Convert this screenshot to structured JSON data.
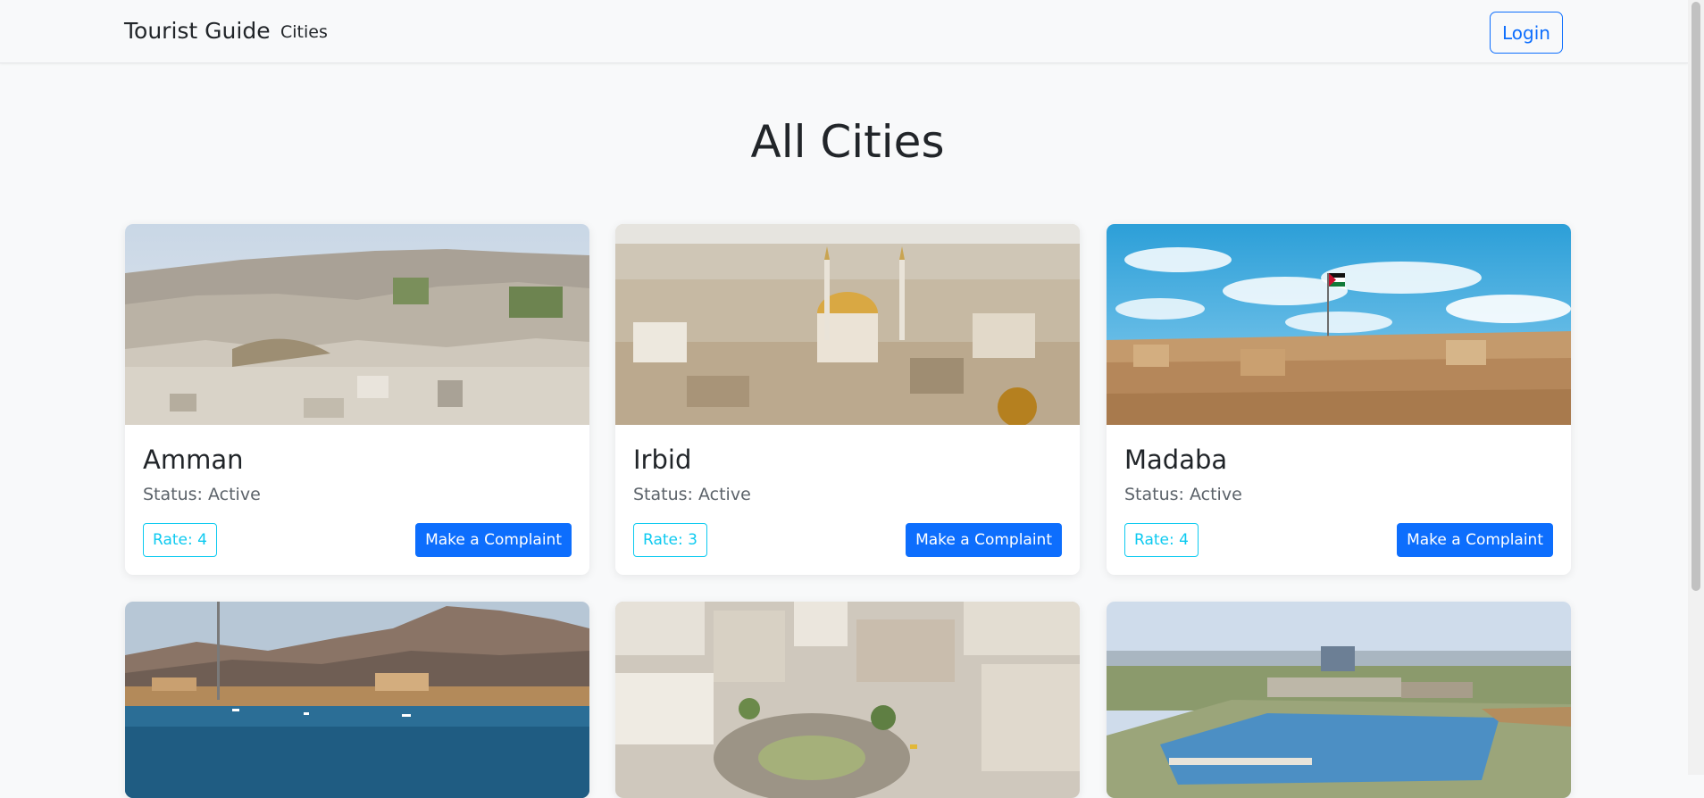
{
  "navbar": {
    "brand": "Tourist Guide",
    "links": [
      "Cities"
    ],
    "login_label": "Login"
  },
  "page": {
    "title": "All Cities"
  },
  "cities": [
    {
      "name": "Amman",
      "status": "Status: Active",
      "rate": "Rate: 4",
      "action": "Make a Complaint",
      "image": "amman-cityscape"
    },
    {
      "name": "Irbid",
      "status": "Status: Active",
      "rate": "Rate: 3",
      "action": "Make a Complaint",
      "image": "irbid-mosque-cityscape"
    },
    {
      "name": "Madaba",
      "status": "Status: Active",
      "rate": "Rate: 4",
      "action": "Make a Complaint",
      "image": "madaba-flag-sky"
    },
    {
      "image": "aqaba-harbor-mountains"
    },
    {
      "image": "city-roundabout-aerial"
    },
    {
      "image": "campus-lake-aerial"
    }
  ],
  "colors": {
    "primary": "#0d6efd",
    "info": "#0dcaf0",
    "background": "#f8f9fa"
  }
}
